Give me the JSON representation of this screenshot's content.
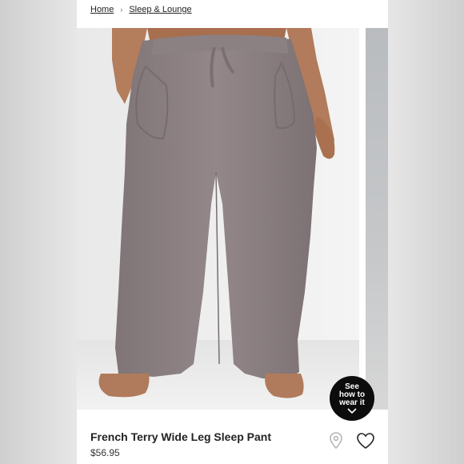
{
  "breadcrumb": {
    "home": "Home",
    "separator": "›",
    "category": "Sleep & Lounge"
  },
  "promo": {
    "line1": "See",
    "line2": "how to",
    "line3": "wear it"
  },
  "product": {
    "title": "French Terry Wide Leg Sleep Pant",
    "price": "$56.95"
  },
  "icons": {
    "store_locator": "location-pin-icon",
    "favorite": "heart-icon",
    "expand": "chevron-down-icon"
  },
  "colors": {
    "pant": "#8c8183",
    "skin": "#b57f5e",
    "promo_bg": "#0c0c0c"
  }
}
